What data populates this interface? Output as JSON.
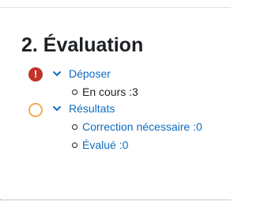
{
  "section": {
    "title": "2. Évaluation"
  },
  "phases": [
    {
      "label": "Déposer",
      "status": "alert",
      "status_icon": "exclamation-circle-icon",
      "tasks": [
        {
          "label": "En cours :3",
          "link": false
        }
      ]
    },
    {
      "label": "Résultats",
      "status": "todo",
      "status_icon": "empty-circle-icon",
      "tasks": [
        {
          "label": "Correction nécessaire :0",
          "link": true
        },
        {
          "label": "Évalué :0",
          "link": true
        }
      ]
    }
  ],
  "colors": {
    "alert": "#c0332b",
    "todo": "#f0ad4e",
    "link": "#0f6cbf",
    "text": "#1d2125"
  }
}
